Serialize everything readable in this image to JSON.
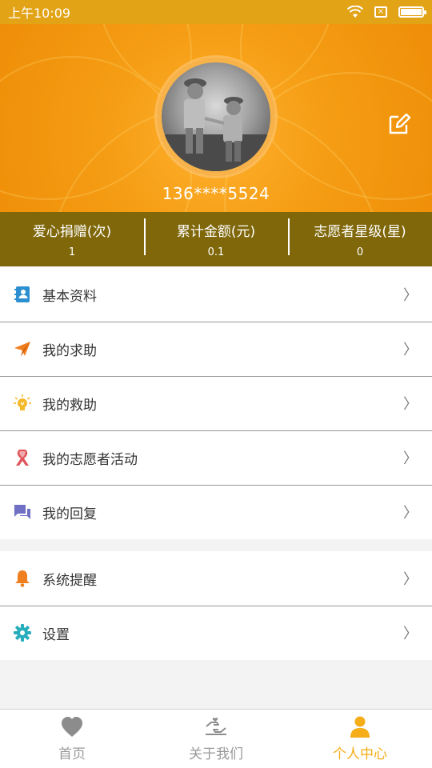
{
  "status_bar": {
    "time": "上午10:09",
    "sim_icon": "sim-x-icon"
  },
  "profile": {
    "phone": "136****5524",
    "edit_icon": "edit-icon"
  },
  "stats": [
    {
      "label": "爱心捐赠(次)",
      "value": "1"
    },
    {
      "label": "累计金额(元)",
      "value": "0.1"
    },
    {
      "label": "志愿者星级(星)",
      "value": "0"
    }
  ],
  "menu_group_1": [
    {
      "label": "基本资料",
      "icon": "contacts-book-icon"
    },
    {
      "label": "我的求助",
      "icon": "paper-plane-icon"
    },
    {
      "label": "我的救助",
      "icon": "lightbulb-icon"
    },
    {
      "label": "我的志愿者活动",
      "icon": "ribbon-icon"
    },
    {
      "label": "我的回复",
      "icon": "chat-bubbles-icon"
    }
  ],
  "menu_group_2": [
    {
      "label": "系统提醒",
      "icon": "bell-icon"
    },
    {
      "label": "设置",
      "icon": "gear-icon"
    }
  ],
  "chevron": "〉",
  "bottom_nav": [
    {
      "label": "首页",
      "icon": "heart-icon",
      "active": false
    },
    {
      "label": "关于我们",
      "icon": "helping-hands-icon",
      "active": false
    },
    {
      "label": "个人中心",
      "icon": "person-icon",
      "active": true
    }
  ],
  "colors": {
    "status_bar": "#e2a316",
    "header": "#f59d14",
    "stats_bar": "#7f670a",
    "accent": "#f5ad18"
  }
}
